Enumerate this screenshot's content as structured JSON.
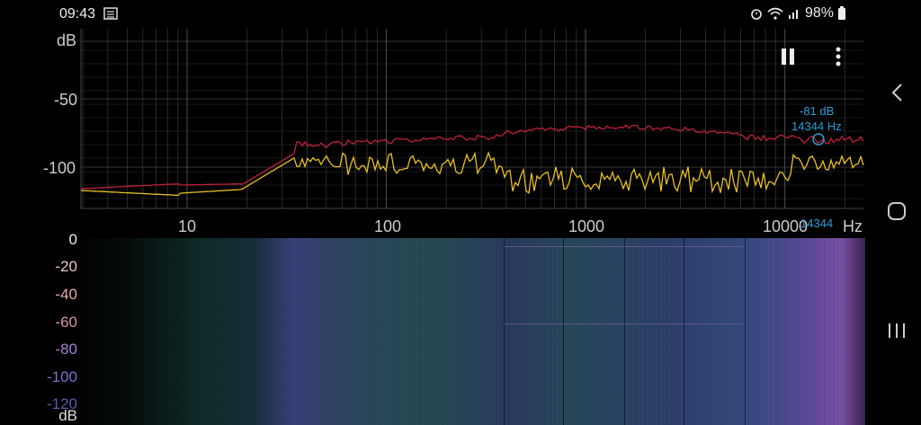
{
  "status_bar": {
    "time": "09:43",
    "battery": "98%"
  },
  "spectrum": {
    "y_unit": "dB",
    "y_ticks": [
      "-50",
      "-100"
    ],
    "x_ticks": [
      "10",
      "100",
      "1000",
      "10000"
    ],
    "x_unit": "Hz",
    "peak_db": "-81 dB",
    "peak_hz": "14344 Hz",
    "cursor_freq": "14344"
  },
  "spectrogram": {
    "db_ticks": [
      "0",
      "-20",
      "-40",
      "-60",
      "-80",
      "-100",
      "-120"
    ],
    "db_unit": "dB"
  },
  "colors": {
    "peak_hold_line": "#c0203a",
    "live_line": "#e8c020",
    "cursor": "#2a9fd8",
    "grid": "#444444"
  },
  "icons": {
    "pause": "pause-icon",
    "menu": "more-vert-icon",
    "back": "back-icon",
    "home": "home-icon",
    "recents": "recents-icon"
  }
}
